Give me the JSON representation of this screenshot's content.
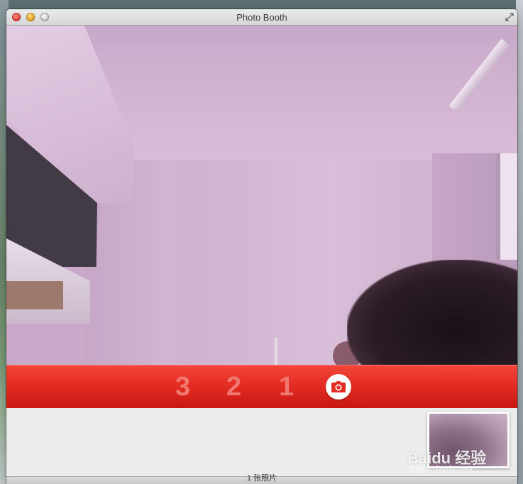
{
  "window": {
    "title": "Photo Booth"
  },
  "countdown": [
    "3",
    "2",
    "1"
  ],
  "status": {
    "photo_count_text": "1 张照片"
  },
  "watermark": {
    "text": "Baidu 经验",
    "url": "jingyan.baidu.com"
  },
  "colors": {
    "control_bar": "#e42d24",
    "countdown_digit": "#f2776f",
    "shutter_icon": "#e42d24"
  },
  "icons": {
    "shutter": "camera-icon",
    "fullscreen": "fullscreen-icon"
  }
}
